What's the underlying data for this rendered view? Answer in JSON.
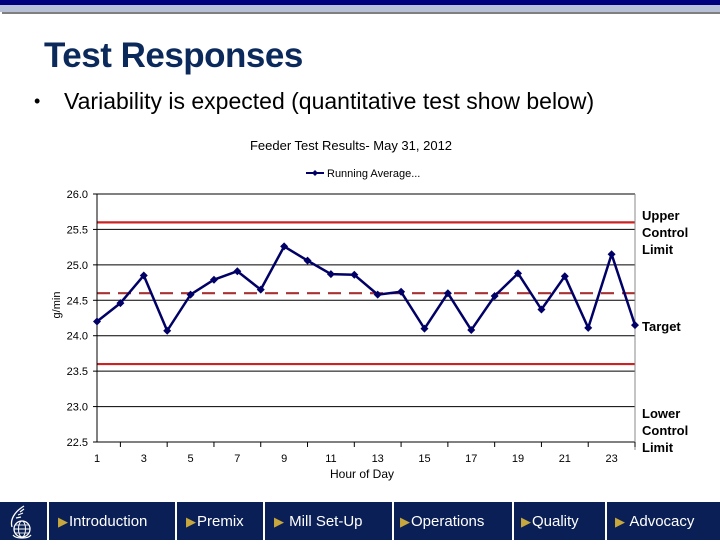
{
  "slide": {
    "title": "Test Responses",
    "bullet": "Variability is expected (quantitative test show below)"
  },
  "colors": {
    "brand_navy": "#0a1f55",
    "title_color": "#0b2a5b",
    "series_color": "#000066",
    "limit_color": "#cc2222",
    "target_color": "#a83232",
    "nav_arrow": "#c8a83c"
  },
  "chart_data": {
    "type": "line",
    "title": "Feeder Test Results- May 31, 2012",
    "xlabel": "Hour of Day",
    "ylabel": "g/min",
    "ylim": [
      22.5,
      26.0
    ],
    "xlim": [
      1,
      24
    ],
    "yticks": [
      "26.0",
      "25.5",
      "25.0",
      "24.5",
      "24.0",
      "23.5",
      "23.0",
      "22.5"
    ],
    "ytick_values": [
      26.0,
      25.5,
      25.0,
      24.5,
      24.0,
      23.5,
      23.0,
      22.5
    ],
    "xtick_labels": [
      "1",
      "3",
      "5",
      "7",
      "9",
      "11",
      "13",
      "15",
      "17",
      "19",
      "21",
      "23"
    ],
    "xtick_values": [
      1,
      3,
      5,
      7,
      9,
      11,
      13,
      15,
      17,
      19,
      21,
      23
    ],
    "grid": true,
    "legend": {
      "position": "top-center",
      "entries": [
        "Running Average..."
      ]
    },
    "series": [
      {
        "name": "Running Average...",
        "marker": "diamond",
        "x": [
          1,
          2,
          3,
          4,
          5,
          6,
          7,
          8,
          9,
          10,
          11,
          12,
          13,
          14,
          15,
          16,
          17,
          18,
          19,
          20,
          21,
          22,
          23,
          24
        ],
        "values": [
          24.2,
          24.46,
          24.85,
          24.07,
          24.58,
          24.79,
          24.91,
          24.65,
          25.26,
          25.06,
          24.87,
          24.86,
          24.58,
          24.62,
          24.1,
          24.6,
          24.08,
          24.56,
          24.88,
          24.37,
          24.84,
          24.11,
          25.15,
          24.15
        ]
      }
    ],
    "reference_lines": [
      {
        "name": "Upper Control Limit",
        "value": 25.6,
        "style": "solid"
      },
      {
        "name": "Target",
        "value": 24.6,
        "style": "dashed"
      },
      {
        "name": "Lower Control Limit",
        "value": 23.6,
        "style": "solid"
      }
    ],
    "annotations": {
      "upper": "Upper Control Limit",
      "target": "Target",
      "lower": "Lower Control Limit"
    }
  },
  "nav": {
    "logo": "globe-wheat-logo",
    "items": [
      {
        "label": "Introduction"
      },
      {
        "label": "Premix"
      },
      {
        "label": "Mill Set-Up"
      },
      {
        "label": "Operations"
      },
      {
        "label": "Quality"
      },
      {
        "label": "Advocacy"
      }
    ]
  }
}
